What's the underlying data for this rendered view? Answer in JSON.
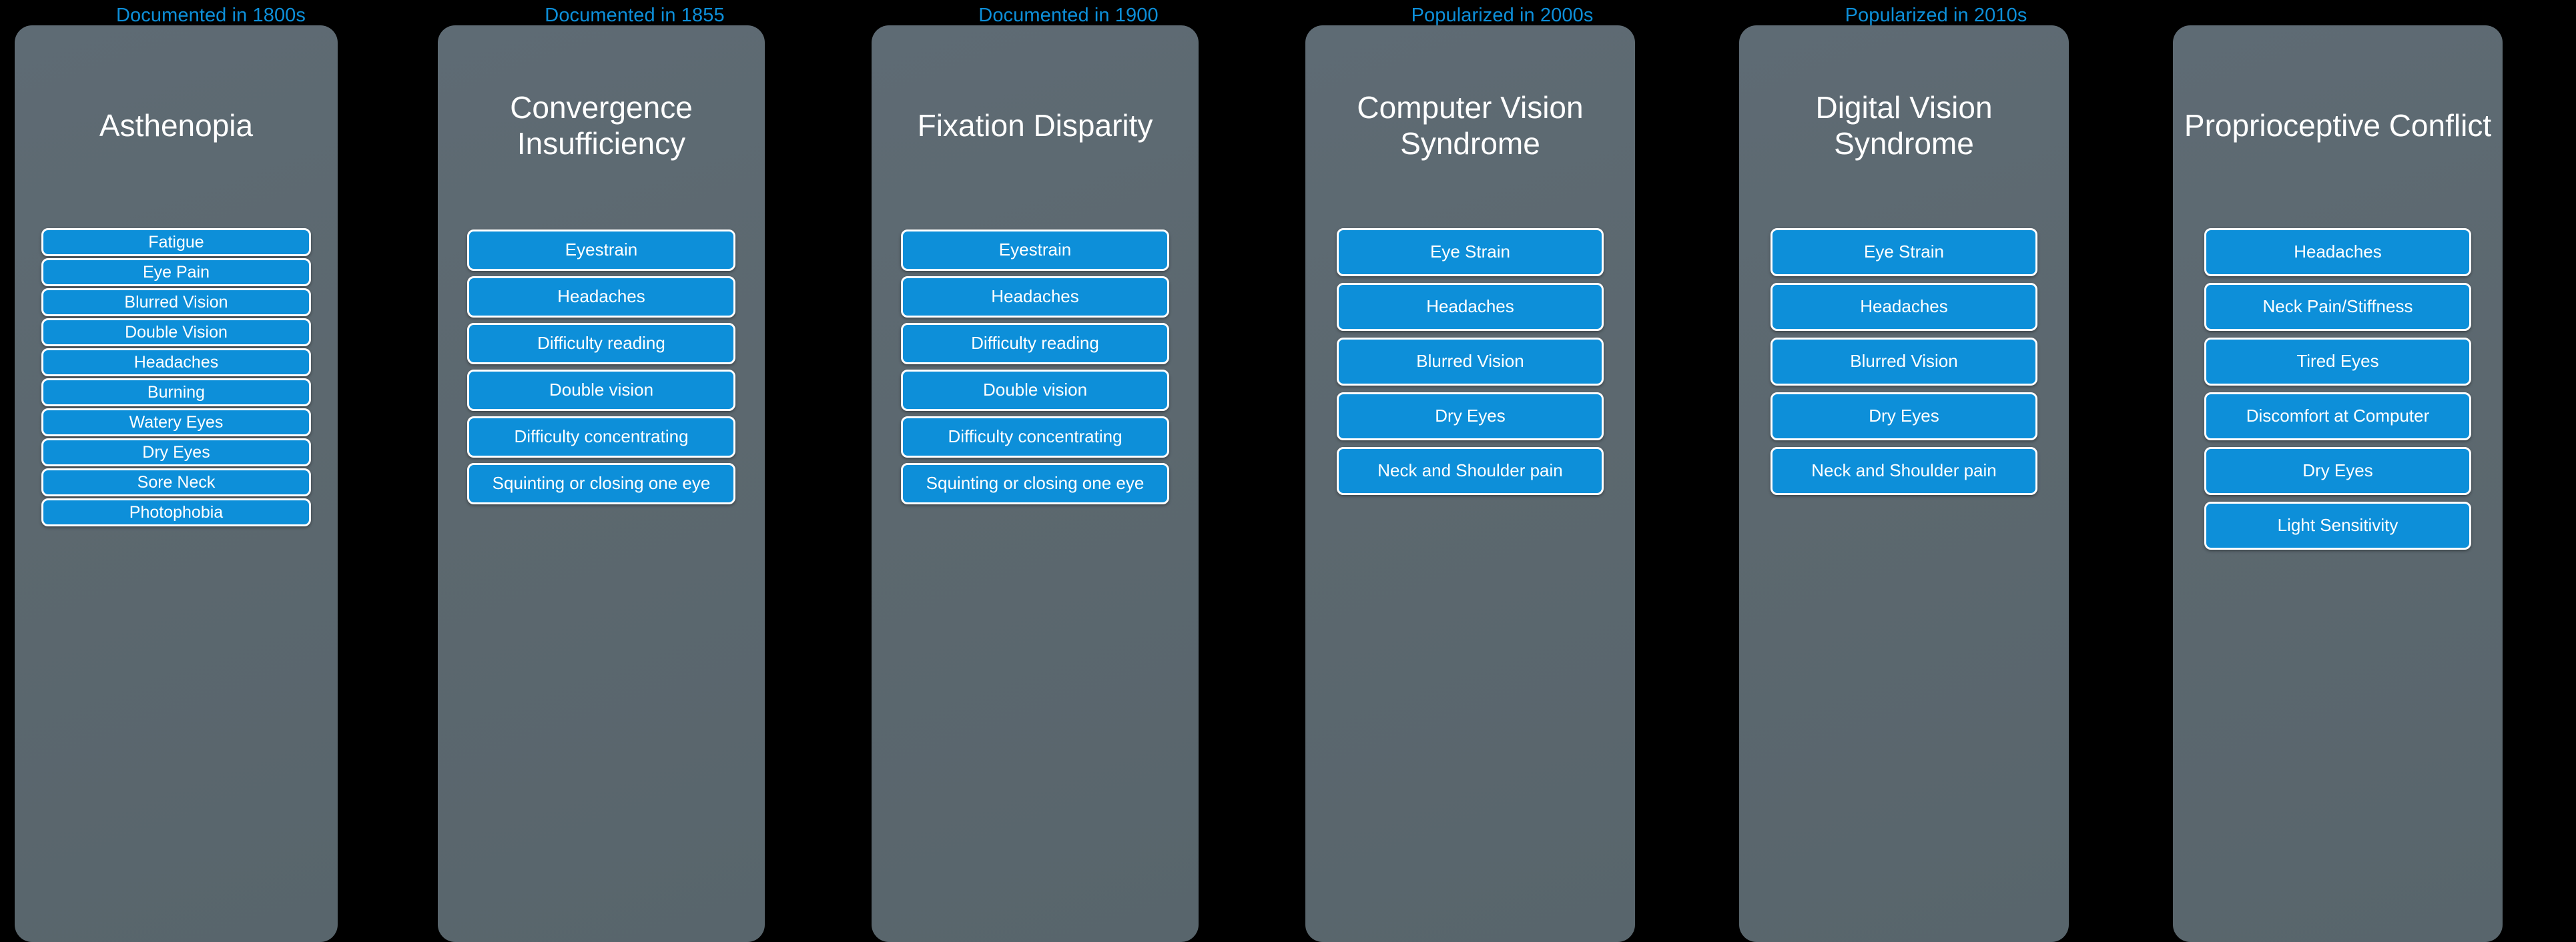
{
  "theme": {
    "background": "#000000",
    "card_bg": "#5c686f",
    "pill_bg": "#0d8fd9",
    "pill_border": "#ffffff",
    "era_label_color": "#0d8fd9",
    "title_color": "#ffffff"
  },
  "columns": [
    {
      "era": "Documented in 1800s",
      "title": "Asthenopia",
      "symptoms": [
        "Fatigue",
        "Eye Pain",
        "Blurred Vision",
        "Double Vision",
        "Headaches",
        "Burning",
        "Watery Eyes",
        "Dry Eyes",
        "Sore Neck",
        "Photophobia"
      ]
    },
    {
      "era": "Documented in 1855",
      "title": "Convergence Insufficiency",
      "symptoms": [
        "Eyestrain",
        "Headaches",
        "Difficulty reading",
        "Double vision",
        "Difficulty concentrating",
        "Squinting or closing one eye"
      ]
    },
    {
      "era": "Documented in 1900",
      "title": "Fixation Disparity",
      "symptoms": [
        "Eyestrain",
        "Headaches",
        "Difficulty reading",
        "Double vision",
        "Difficulty concentrating",
        "Squinting or closing one eye"
      ]
    },
    {
      "era": "Popularized in 2000s",
      "title": "Computer Vision Syndrome",
      "symptoms": [
        "Eye Strain",
        "Headaches",
        "Blurred Vision",
        "Dry Eyes",
        "Neck and Shoulder pain"
      ]
    },
    {
      "era": "Popularized in 2010s",
      "title": "Digital Vision Syndrome",
      "symptoms": [
        "Eye Strain",
        "Headaches",
        "Blurred Vision",
        "Dry Eyes",
        "Neck and Shoulder pain"
      ]
    },
    {
      "era": "",
      "title": "Proprioceptive Conflict",
      "symptoms": [
        "Headaches",
        "Neck Pain/Stiffness",
        "Tired Eyes",
        "Discomfort at Computer",
        "Dry Eyes",
        "Light Sensitivity"
      ]
    }
  ]
}
